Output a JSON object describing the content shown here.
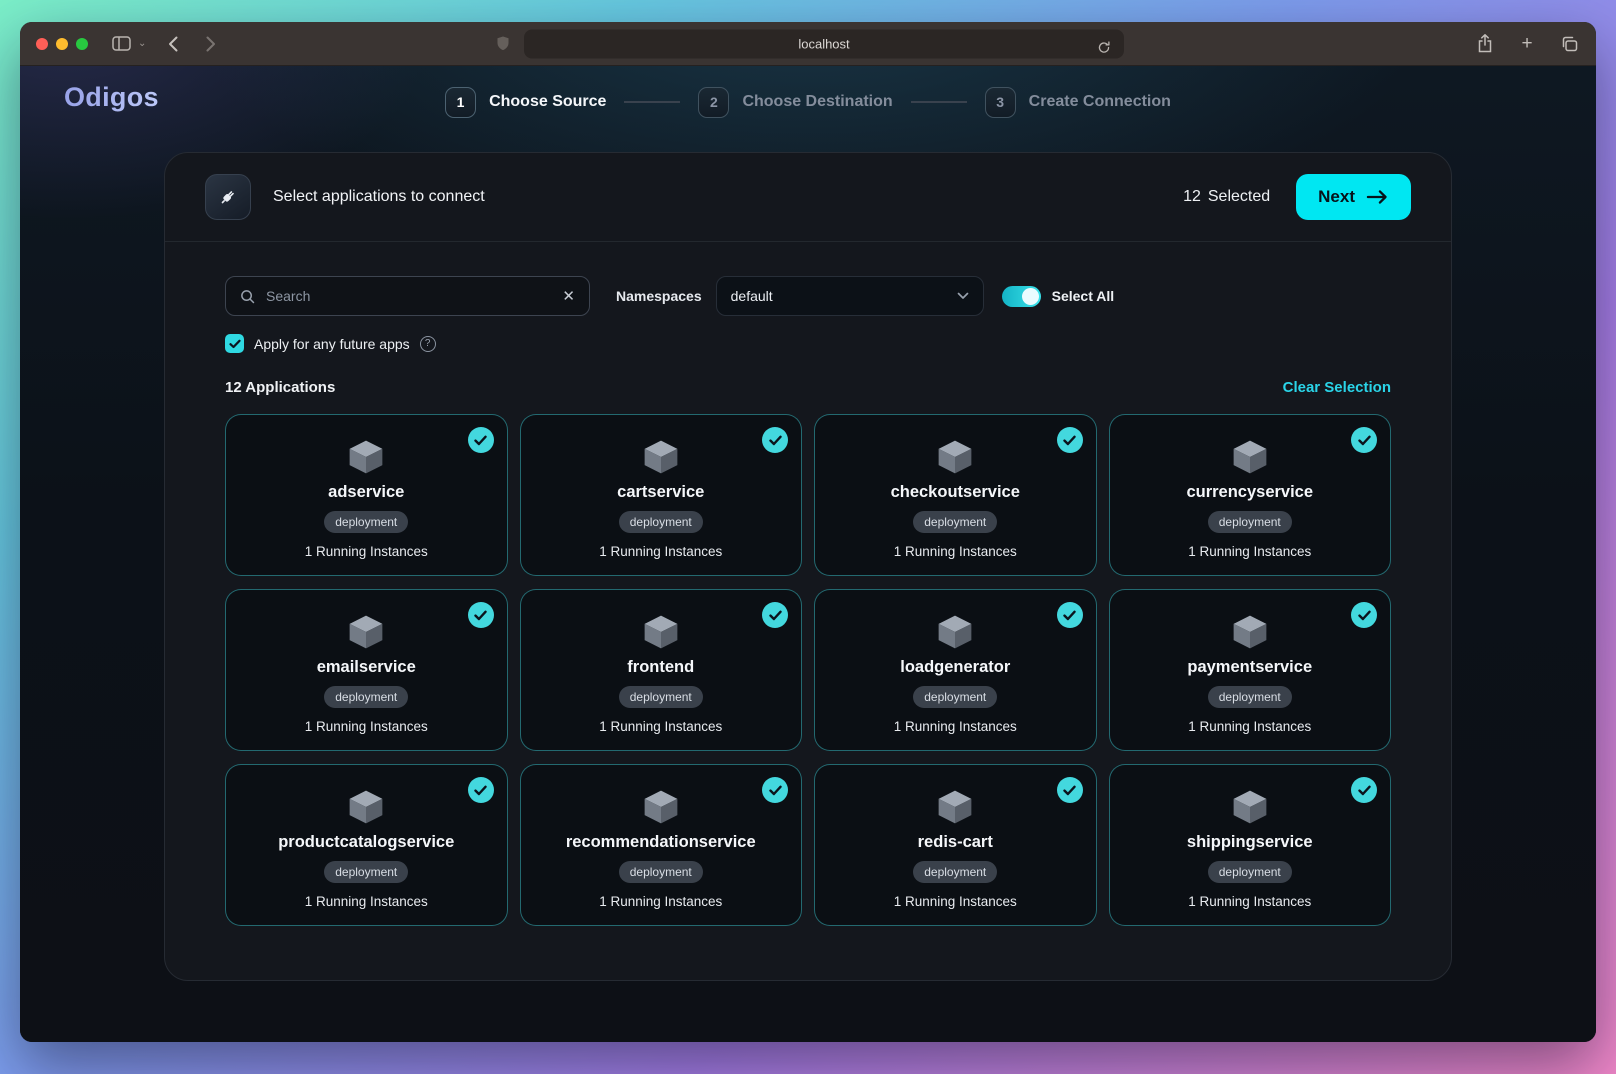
{
  "browser": {
    "url": "localhost"
  },
  "page": {
    "brand": "Odigos"
  },
  "stepper": {
    "steps": [
      {
        "number": "1",
        "label": "Choose Source",
        "active": true
      },
      {
        "number": "2",
        "label": "Choose Destination",
        "active": false
      },
      {
        "number": "3",
        "label": "Create Connection",
        "active": false
      }
    ]
  },
  "panel": {
    "title": "Select applications to connect",
    "selected_count": "12",
    "selected_label": "Selected",
    "next_button": "Next"
  },
  "filters": {
    "search_placeholder": "Search",
    "namespaces_label": "Namespaces",
    "namespace_selected": "default",
    "select_all_label": "Select All",
    "select_all_on": true,
    "future_apps_label": "Apply for any future apps",
    "future_apps_checked": true
  },
  "applications": {
    "count_label": "12 Applications",
    "clear_selection_label": "Clear Selection",
    "items": [
      {
        "name": "adservice",
        "kind": "deployment",
        "instances": "1 Running Instances",
        "selected": true
      },
      {
        "name": "cartservice",
        "kind": "deployment",
        "instances": "1 Running Instances",
        "selected": true
      },
      {
        "name": "checkoutservice",
        "kind": "deployment",
        "instances": "1 Running Instances",
        "selected": true
      },
      {
        "name": "currencyservice",
        "kind": "deployment",
        "instances": "1 Running Instances",
        "selected": true
      },
      {
        "name": "emailservice",
        "kind": "deployment",
        "instances": "1 Running Instances",
        "selected": true
      },
      {
        "name": "frontend",
        "kind": "deployment",
        "instances": "1 Running Instances",
        "selected": true
      },
      {
        "name": "loadgenerator",
        "kind": "deployment",
        "instances": "1 Running Instances",
        "selected": true
      },
      {
        "name": "paymentservice",
        "kind": "deployment",
        "instances": "1 Running Instances",
        "selected": true
      },
      {
        "name": "productcatalogservice",
        "kind": "deployment",
        "instances": "1 Running Instances",
        "selected": true
      },
      {
        "name": "recommendationservice",
        "kind": "deployment",
        "instances": "1 Running Instances",
        "selected": true
      },
      {
        "name": "redis-cart",
        "kind": "deployment",
        "instances": "1 Running Instances",
        "selected": true
      },
      {
        "name": "shippingservice",
        "kind": "deployment",
        "instances": "1 Running Instances",
        "selected": true
      }
    ]
  },
  "icons": {
    "connect-icon": "plug",
    "package-icon": "3d-cube",
    "selected-check-icon": "check-circle",
    "search-icon": "magnifier",
    "clear-search-icon": "x",
    "chevron-down-icon": "chevron-down",
    "help-icon": "question-circle",
    "next-arrow-icon": "arrow-right"
  },
  "colors": {
    "accent_cyan": "#00e7f2",
    "check_teal": "#43d8de",
    "card_border_teal": "rgba(64,214,224,0.45)",
    "panel_bg": "#14171d",
    "page_bg": "#0d1016",
    "chrome_bg": "#3a3432"
  }
}
